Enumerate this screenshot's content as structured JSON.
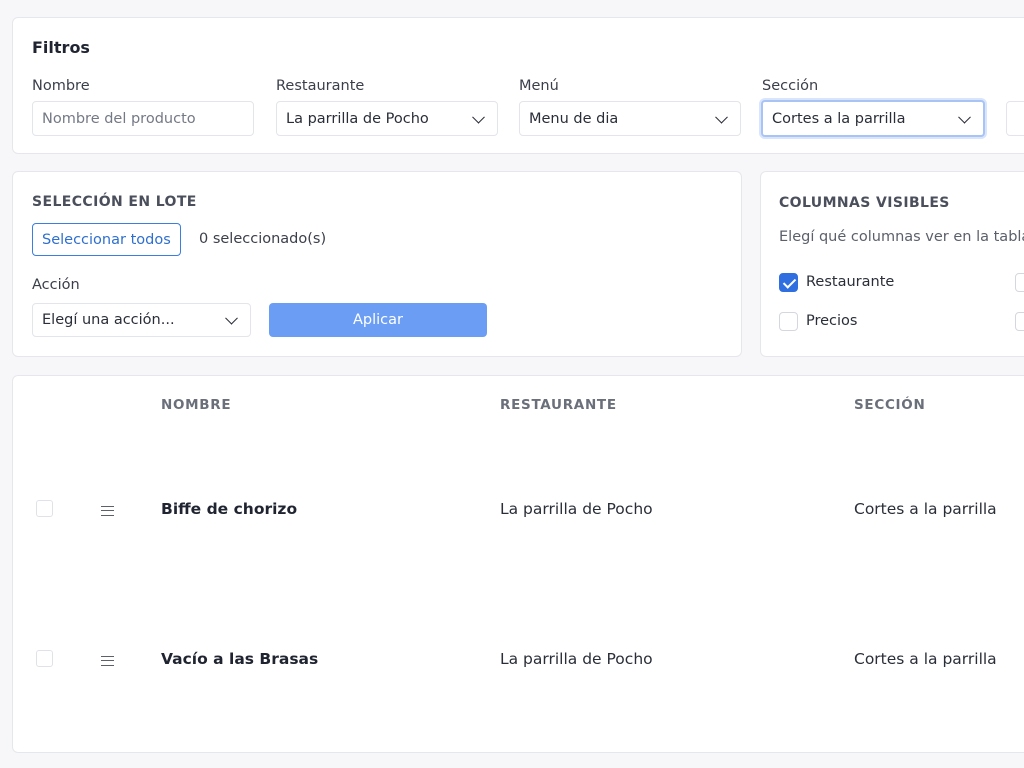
{
  "filters": {
    "title": "Filtros",
    "nombre": {
      "label": "Nombre",
      "placeholder": "Nombre del producto",
      "value": ""
    },
    "restaurante": {
      "label": "Restaurante",
      "value": "La parrilla de Pocho"
    },
    "menu": {
      "label": "Menú",
      "value": "Menu de dia"
    },
    "seccion": {
      "label": "Sección",
      "value": "Cortes a la parrilla"
    }
  },
  "batch": {
    "title": "SELECCIÓN EN LOTE",
    "select_all_label": "Seleccionar todos",
    "selected_count": "0 seleccionado(s)",
    "action_label": "Acción",
    "action_value": "Elegí una acción...",
    "apply_label": "Aplicar"
  },
  "columns": {
    "title": "COLUMNAS VISIBLES",
    "subtitle": "Elegí qué columnas ver en la tabla",
    "options": [
      {
        "label": "Restaurante",
        "checked": true
      },
      {
        "label": "Precios",
        "checked": false
      }
    ]
  },
  "table": {
    "headers": [
      "NOMBRE",
      "RESTAURANTE",
      "SECCIÓN"
    ],
    "rows": [
      {
        "nombre": "Biffe de chorizo",
        "restaurante": "La parrilla de Pocho",
        "seccion": "Cortes a la parrilla"
      },
      {
        "nombre": "Vacío a las Brasas",
        "restaurante": "La parrilla de Pocho",
        "seccion": "Cortes a la parrilla"
      }
    ]
  },
  "colors": {
    "primary": "#2f6fe0",
    "primary_button": "#6b9df5",
    "background": "#f7f7fa"
  }
}
